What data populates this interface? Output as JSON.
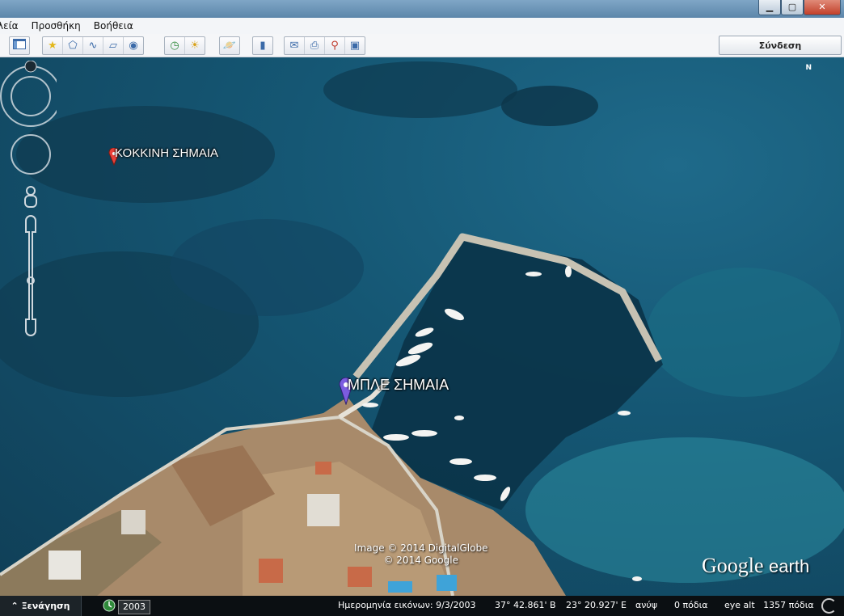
{
  "window": {
    "min_label": "▁",
    "max_label": "▢",
    "close_label": "✕"
  },
  "menu": {
    "items": [
      "λεία",
      "Προσθήκη",
      "Βοήθεια"
    ]
  },
  "toolbar": {
    "sidebar_icon": "sidebar-icon",
    "sign_in": "Σύνδεση"
  },
  "map": {
    "placemarks": [
      {
        "label": "ΚΟΚΚΙΝΗ ΣΗΜΑΙΑ",
        "color": "#e8413a"
      },
      {
        "label": "ΜΠΛΕ ΣΗΜΑΙΑ",
        "color": "#7b5ce0"
      }
    ],
    "attribution": [
      "Image © 2014 DigitalGlobe",
      "© 2014 Google"
    ],
    "logo_google": "Google",
    "logo_earth": "earth",
    "compass_n": "N"
  },
  "status": {
    "tour": "Ξενάγηση",
    "year": "2003",
    "imagery_date": "Ημερομηνία εικόνων: 9/3/2003",
    "lat": "37° 42.861' Β",
    "lon": "23° 20.927' Ε",
    "elevation": "ανύψ      0 πόδια",
    "eye_alt": "eye alt   1357 πόδια"
  }
}
